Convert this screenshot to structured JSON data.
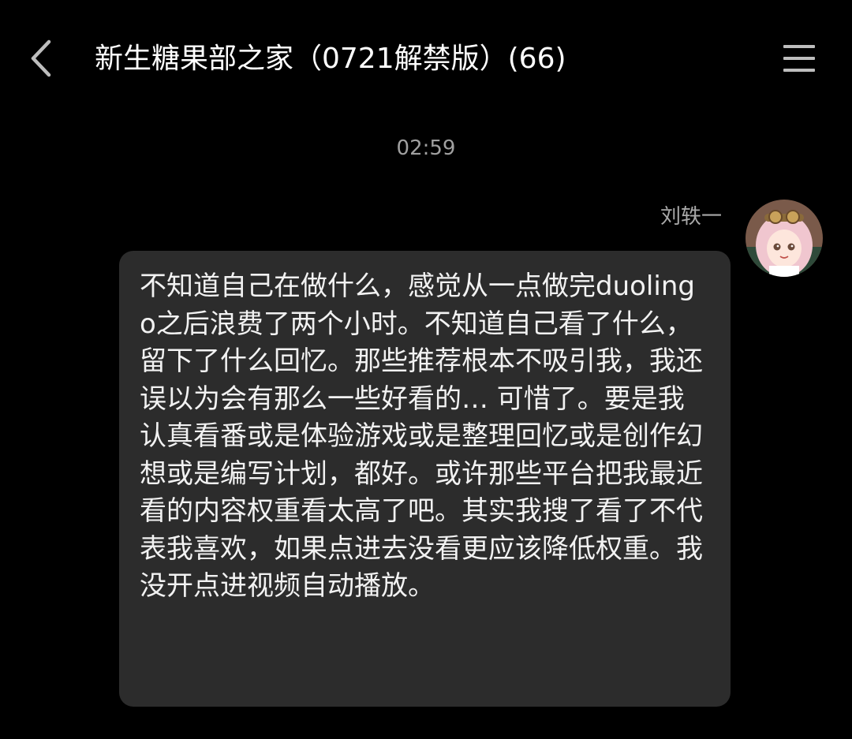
{
  "header": {
    "back_icon": "chevron-left-icon",
    "title": "新生糖果部之家（0721解禁版）(66)",
    "menu_icon": "hamburger-menu-icon"
  },
  "chat": {
    "timestamp": "02:59",
    "messages": [
      {
        "sender": "刘轶一",
        "avatar": "avatar-image",
        "text": "不知道自己在做什么，感觉从一点做完duolingo之后浪费了两个小时。不知道自己看了什么，留下了什么回忆。那些推荐根本不吸引我，我还误以为会有那么一些好看的… 可惜了。要是我认真看番或是体验游戏或是整理回忆或是创作幻想或是编写计划，都好。或许那些平台把我最近看的内容权重看太高了吧。其实我搜了看了不代表我喜欢，如果点进去没看更应该降低权重。我没开点进视频自动播放。"
      }
    ]
  },
  "colors": {
    "background": "#000000",
    "bubble": "#2c2c2c",
    "text": "#f2f2f2",
    "muted": "#a0a0a0"
  }
}
